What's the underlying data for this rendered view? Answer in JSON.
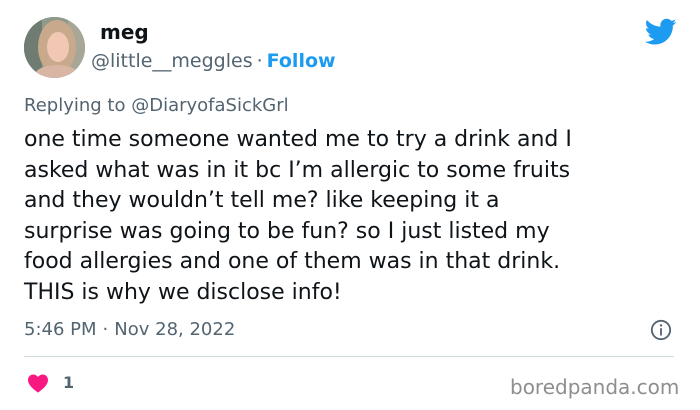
{
  "author": {
    "name": "meg",
    "handle": "@little__meggles",
    "separator": "·",
    "follow_label": "Follow"
  },
  "reply": {
    "prefix": "Replying to",
    "mention": "@DiaryofaSickGrl"
  },
  "tweet": {
    "lines": [
      "one time someone wanted me to try a drink and I",
      "asked what was in it bc I’m allergic to some fruits",
      "and they wouldn’t tell me? like keeping it a",
      "surprise was going to be fun? so I just listed my",
      "food allergies and one of them was in that drink.",
      "THIS is why we disclose info!"
    ]
  },
  "meta": {
    "time": "5:46 PM",
    "separator": "·",
    "date": "Nov 28, 2022"
  },
  "engagement": {
    "like_count": "1"
  },
  "watermark": "boredpanda.com",
  "icons": {
    "brand": "twitter-bird-icon",
    "info": "info-icon",
    "like": "heart-icon"
  },
  "colors": {
    "accent": "#1d9bf0",
    "secondary_text": "#536471",
    "heart": "#f91880",
    "divider": "#cfd9de"
  }
}
